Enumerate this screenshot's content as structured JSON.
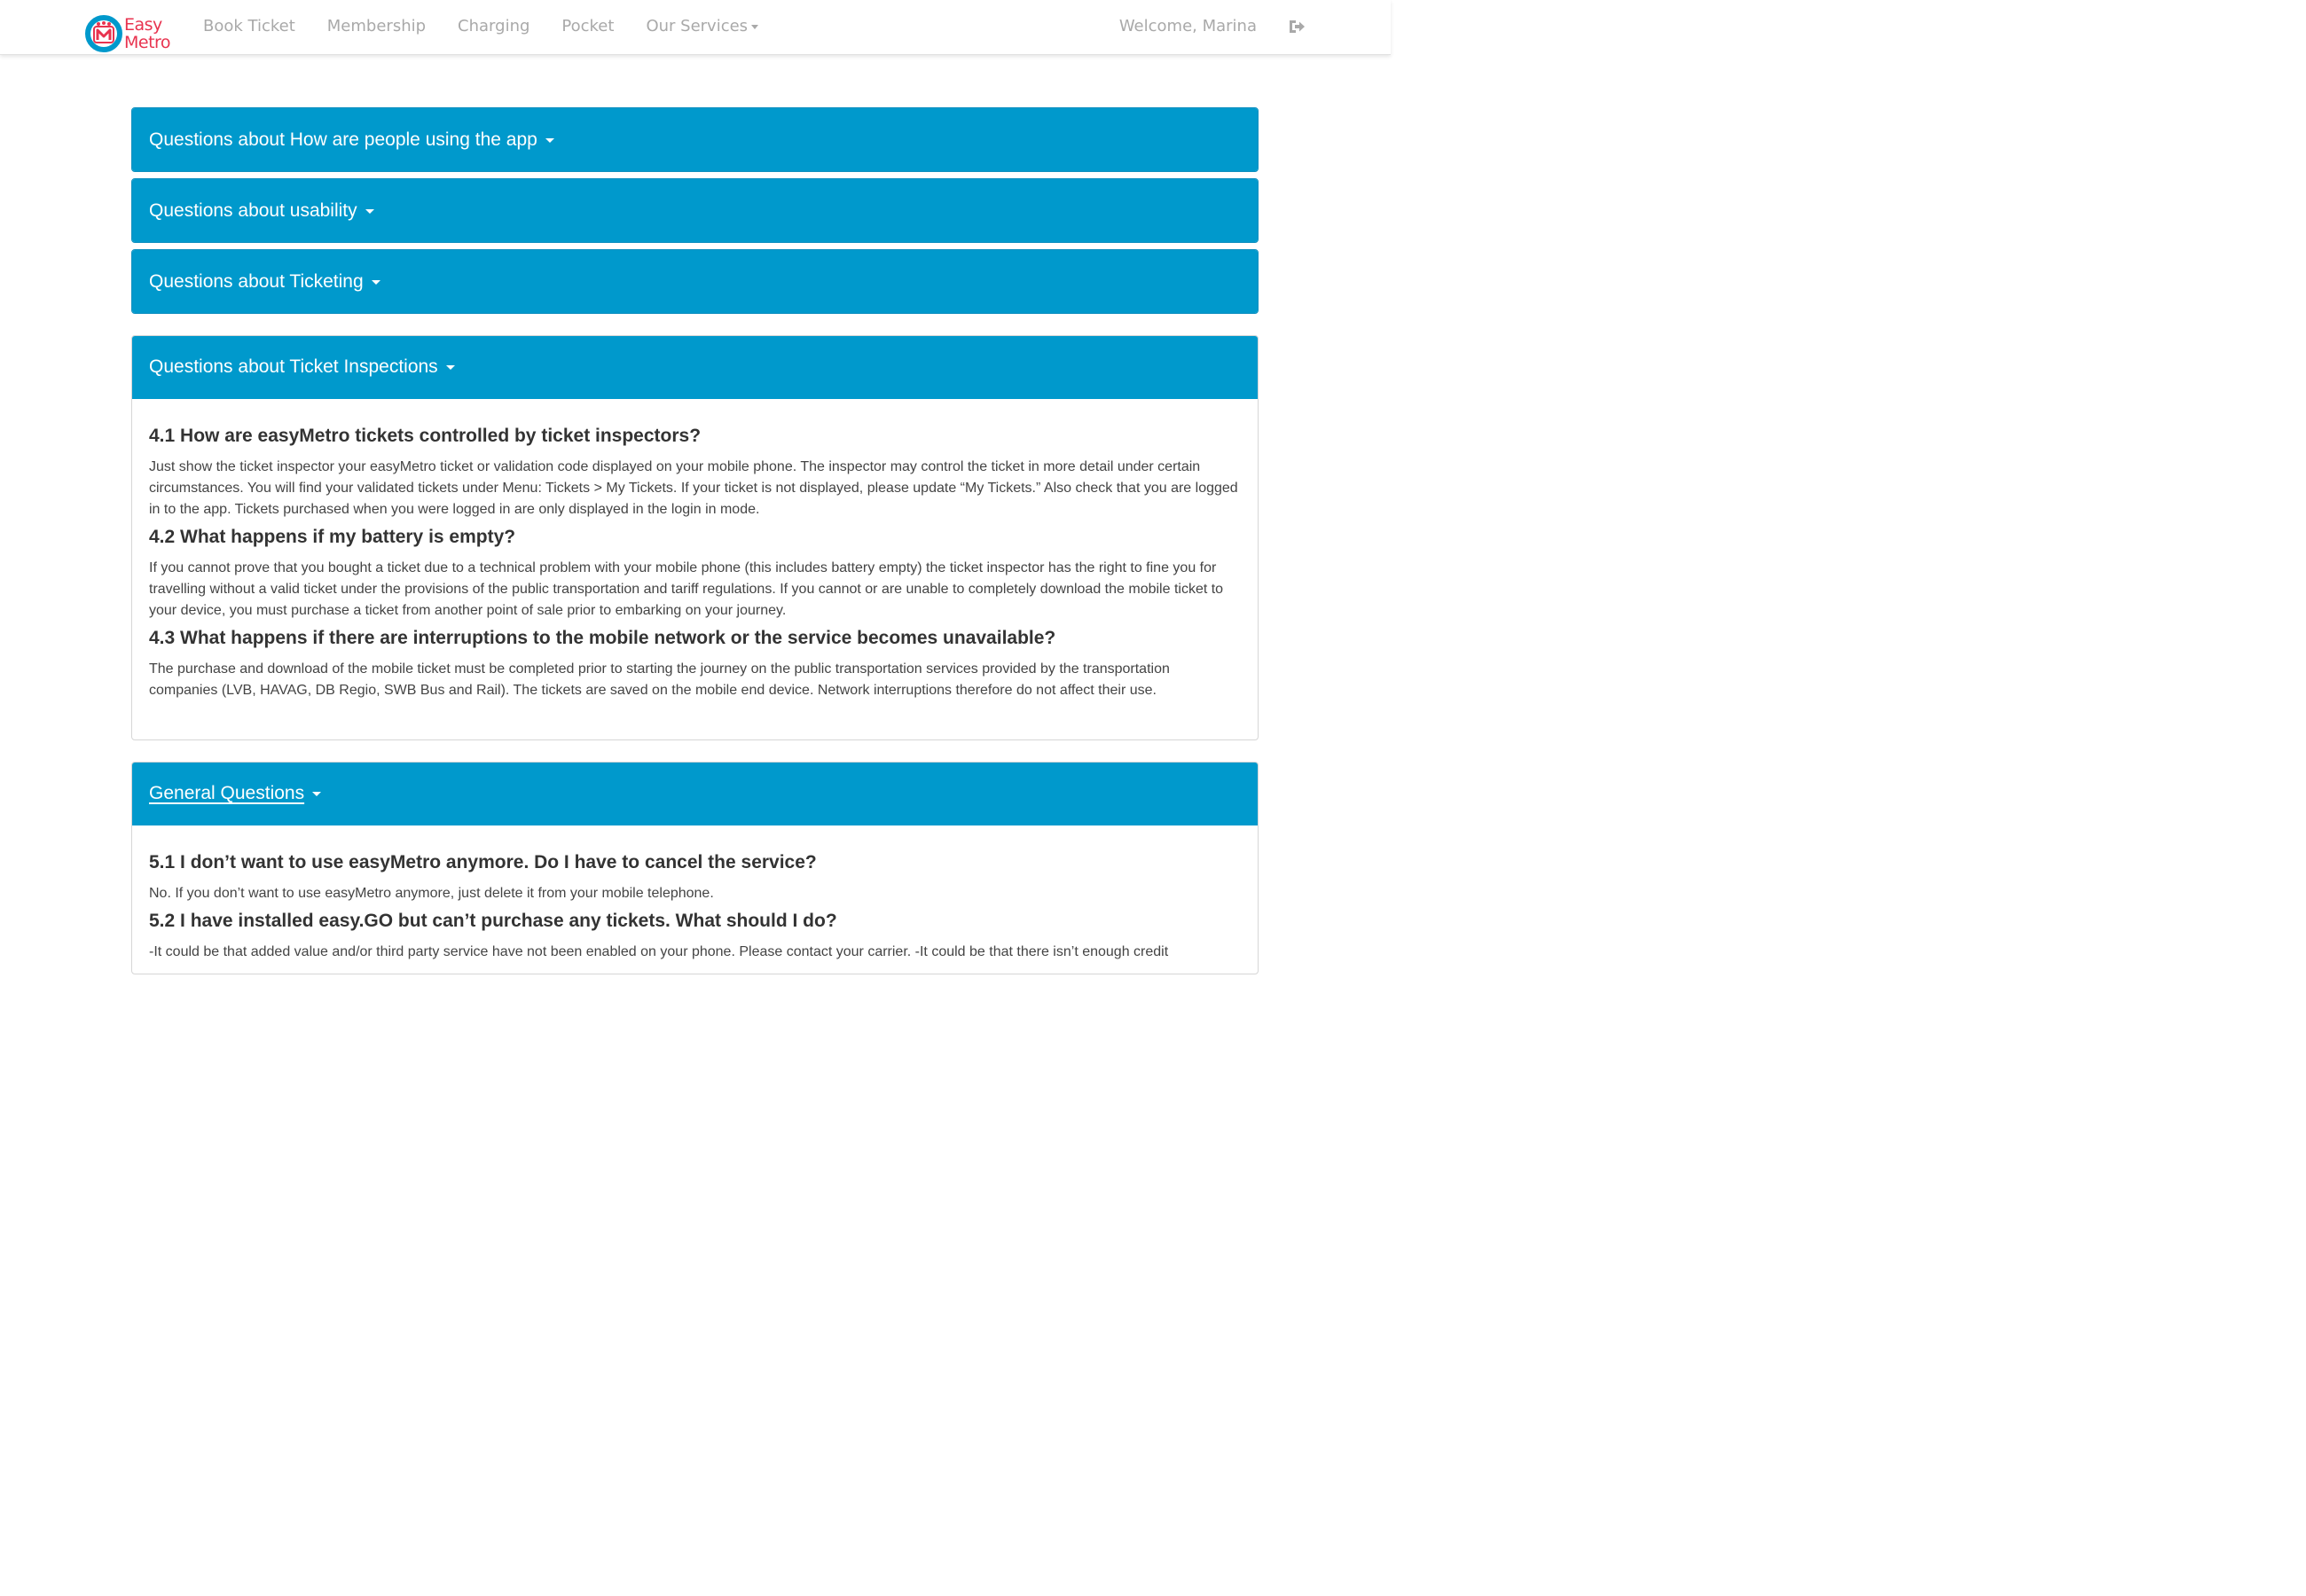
{
  "brand": {
    "line1": "Easy",
    "line2": "Metro",
    "accent": "#e8334f",
    "ring": "#0099cc"
  },
  "nav": {
    "links": [
      "Book Ticket",
      "Membership",
      "Charging",
      "Pocket",
      "Our Services"
    ],
    "welcome": "Welcome, Marina",
    "logout_icon": "sign-out-icon"
  },
  "colors": {
    "panel_heading": "#0099cc",
    "nav_text": "#a9a9a9"
  },
  "faq": {
    "sections": [
      {
        "title": "Questions about How are people using the app",
        "expanded": false
      },
      {
        "title": "Questions about usability",
        "expanded": false
      },
      {
        "title": "Questions about Ticketing",
        "expanded": false
      },
      {
        "title": "Questions about Ticket Inspections",
        "expanded": true,
        "items": [
          {
            "q": "4.1 How are easyMetro tickets controlled by ticket inspectors?",
            "a": "Just show the ticket inspector your easyMetro ticket or validation code displayed on your mobile phone. The inspector may control the ticket in more detail under certain circumstances. You will find your validated tickets under Menu: Tickets > My Tickets. If your ticket is not displayed, please update “My Tickets.” Also check that you are logged in to the app. Tickets purchased when you were logged in are only displayed in the login in mode."
          },
          {
            "q": "4.2 What happens if my battery is empty?",
            "a": "If you cannot prove that you bought a ticket due to a technical problem with your mobile phone (this includes battery empty) the ticket inspector has the right to fine you for travelling without a valid ticket under the provisions of the public transportation and tariff regulations. If you cannot or are unable to completely download the mobile ticket to your device, you must purchase a ticket from another point of sale prior to embarking on your journey."
          },
          {
            "q": "4.3 What happens if there are interruptions to the mobile network or the service becomes unavailable?",
            "a": "The purchase and download of the mobile ticket must be completed prior to starting the journey on the public transportation services provided by the transportation companies (LVB, HAVAG, DB Regio, SWB Bus and Rail). The tickets are saved on the mobile end device. Network interruptions therefore do not affect their use."
          }
        ]
      },
      {
        "title": "General Questions",
        "expanded": true,
        "items": [
          {
            "q": "5.1 I don’t want to use easyMetro anymore. Do I have to cancel the service?",
            "a": "No. If you don’t want to use easyMetro anymore, just delete it from your mobile telephone."
          },
          {
            "q": "5.2 I have installed easy.GO but can’t purchase any tickets. What should I do?",
            "a": "-It could be that added value and/or third party service have not been enabled on your phone. Please contact your carrier. -It could be that there isn’t enough credit"
          }
        ]
      }
    ]
  }
}
